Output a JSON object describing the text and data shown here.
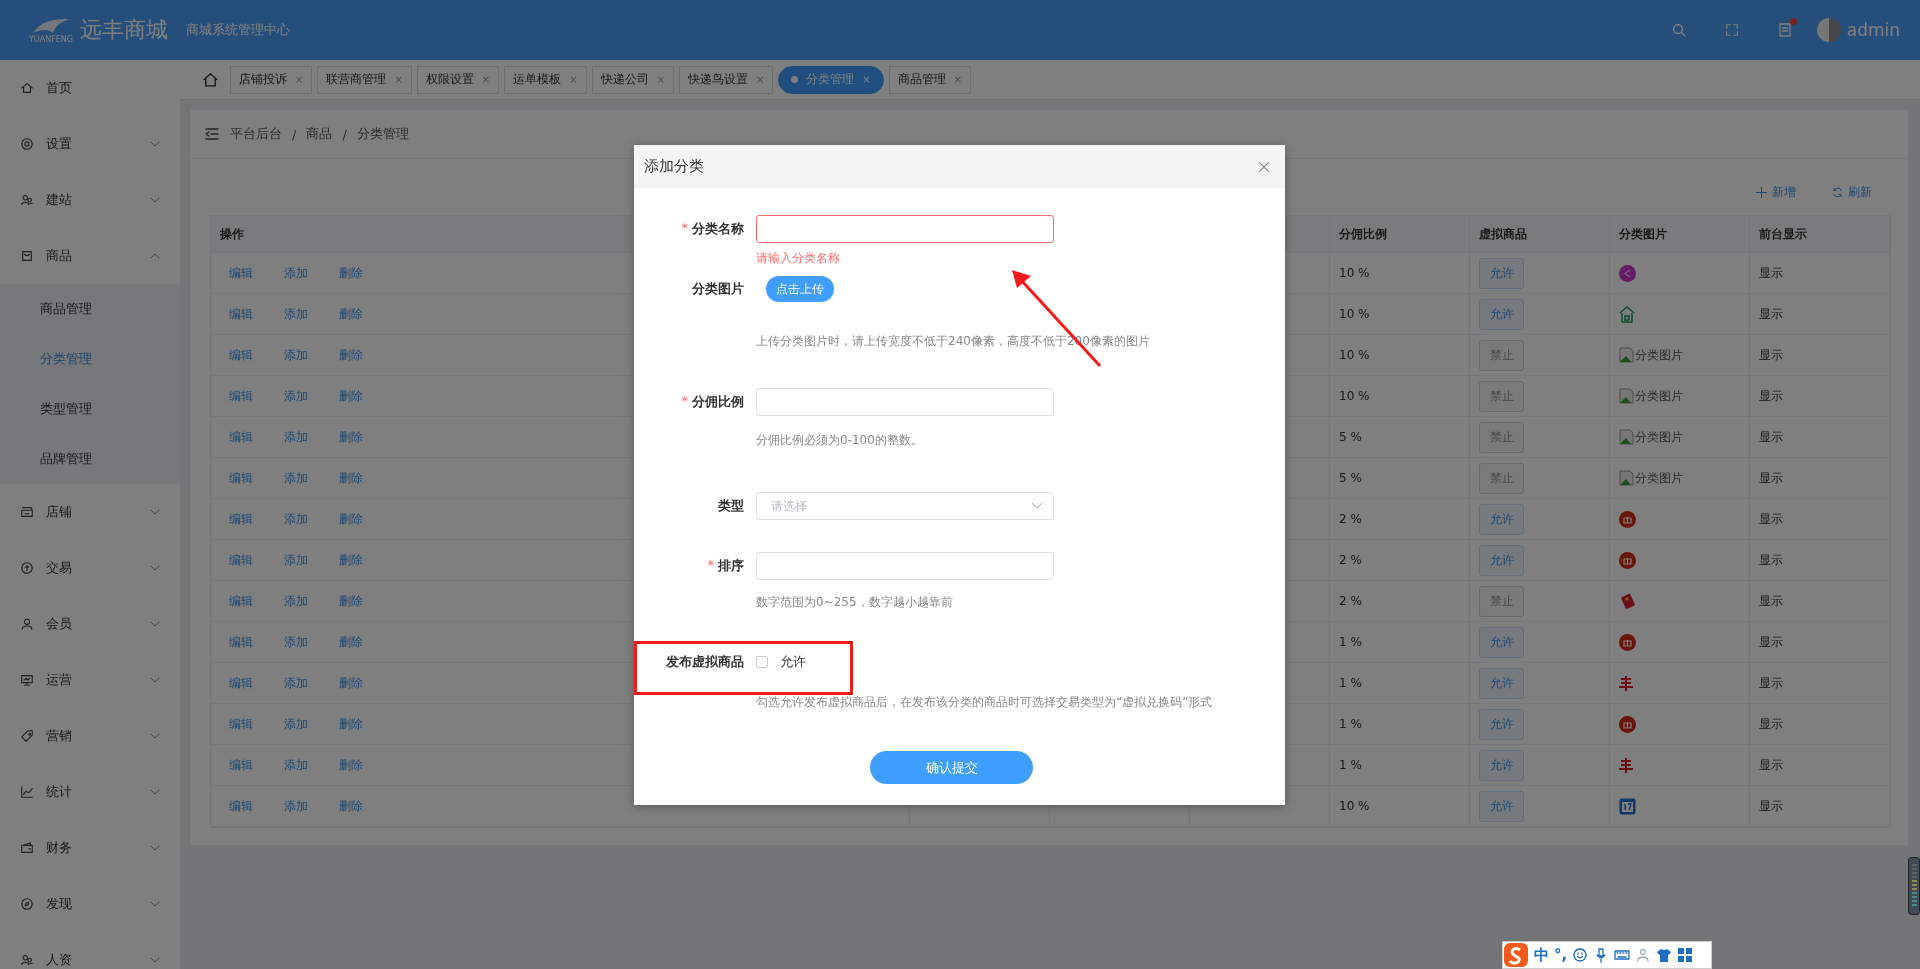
{
  "header": {
    "logo_text": "远丰商城",
    "logo_sub": "YUANFENG",
    "subtitle": "商城系统管理中心",
    "user": "admin"
  },
  "sidebar": {
    "items": [
      {
        "label": "首页",
        "kind": "link"
      },
      {
        "label": "设置",
        "kind": "menu",
        "expanded": false
      },
      {
        "label": "建站",
        "kind": "menu",
        "expanded": false
      },
      {
        "label": "商品",
        "kind": "menu",
        "expanded": true,
        "children": [
          {
            "label": "商品管理",
            "selected": false
          },
          {
            "label": "分类管理",
            "selected": true
          },
          {
            "label": "类型管理",
            "selected": false
          },
          {
            "label": "品牌管理",
            "selected": false
          }
        ]
      },
      {
        "label": "店铺",
        "kind": "menu",
        "expanded": false
      },
      {
        "label": "交易",
        "kind": "menu",
        "expanded": false
      },
      {
        "label": "会员",
        "kind": "menu",
        "expanded": false
      },
      {
        "label": "运营",
        "kind": "menu",
        "expanded": false
      },
      {
        "label": "营销",
        "kind": "menu",
        "expanded": false
      },
      {
        "label": "统计",
        "kind": "menu",
        "expanded": false
      },
      {
        "label": "财务",
        "kind": "menu",
        "expanded": false
      },
      {
        "label": "发现",
        "kind": "menu",
        "expanded": false
      },
      {
        "label": "人资",
        "kind": "menu",
        "expanded": false
      }
    ]
  },
  "tabs": [
    {
      "label": "店铺投诉",
      "close": "×",
      "selected": false
    },
    {
      "label": "联营商管理",
      "close": "×",
      "selected": false
    },
    {
      "label": "权限设置",
      "close": "×",
      "selected": false
    },
    {
      "label": "运单模板",
      "close": "×",
      "selected": false
    },
    {
      "label": "快递公司",
      "close": "×",
      "selected": false
    },
    {
      "label": "快递鸟设置",
      "close": "×",
      "selected": false
    },
    {
      "label": "分类管理",
      "close": "×",
      "selected": true
    },
    {
      "label": "商品管理",
      "close": "×",
      "selected": false
    }
  ],
  "breadcrumb": [
    "平台后台",
    "/",
    "商品",
    "/",
    "分类管理"
  ],
  "toolbar": {
    "add": "新增",
    "refresh": "刷新"
  },
  "table": {
    "columns": [
      "操作",
      "分佣比例",
      "虚拟商品",
      "分类图片",
      "前台显示"
    ],
    "rows": [
      {
        "actions": [
          "编辑",
          "添加",
          "删除"
        ],
        "rate": "10 %",
        "virtual": {
          "label": "允许",
          "allowed": true
        },
        "image": {
          "kind": "share"
        },
        "display": "显示"
      },
      {
        "actions": [
          "编辑",
          "添加",
          "删除"
        ],
        "rate": "10 %",
        "virtual": {
          "label": "允许",
          "allowed": true
        },
        "image": {
          "kind": "house"
        },
        "display": "显示"
      },
      {
        "actions": [
          "编辑",
          "添加",
          "删除"
        ],
        "rate": "10 %",
        "virtual": {
          "label": "禁止",
          "allowed": false
        },
        "image": {
          "kind": "broken",
          "alt": "分类图片"
        },
        "display": "显示"
      },
      {
        "actions": [
          "编辑",
          "添加",
          "删除"
        ],
        "rate": "10 %",
        "virtual": {
          "label": "禁止",
          "allowed": false
        },
        "image": {
          "kind": "broken",
          "alt": "分类图片"
        },
        "display": "显示"
      },
      {
        "actions": [
          "编辑",
          "添加",
          "删除"
        ],
        "rate": "5 %",
        "virtual": {
          "label": "禁止",
          "allowed": false
        },
        "image": {
          "kind": "broken",
          "alt": "分类图片"
        },
        "display": "显示"
      },
      {
        "actions": [
          "编辑",
          "添加",
          "删除"
        ],
        "rate": "5 %",
        "virtual": {
          "label": "禁止",
          "allowed": false
        },
        "image": {
          "kind": "broken",
          "alt": "分类图片"
        },
        "display": "显示"
      },
      {
        "actions": [
          "编辑",
          "添加",
          "删除"
        ],
        "rate": "2 %",
        "virtual": {
          "label": "允许",
          "allowed": true
        },
        "image": {
          "kind": "gift"
        },
        "display": "显示"
      },
      {
        "actions": [
          "编辑",
          "添加",
          "删除"
        ],
        "rate": "2 %",
        "virtual": {
          "label": "允许",
          "allowed": true
        },
        "image": {
          "kind": "gift"
        },
        "display": "显示"
      },
      {
        "actions": [
          "编辑",
          "添加",
          "删除"
        ],
        "rate": "2 %",
        "virtual": {
          "label": "禁止",
          "allowed": false
        },
        "image": {
          "kind": "envelope"
        },
        "display": "显示"
      },
      {
        "actions": [
          "编辑",
          "添加",
          "删除"
        ],
        "rate": "1 %",
        "virtual": {
          "label": "允许",
          "allowed": true
        },
        "image": {
          "kind": "gift"
        },
        "display": "显示"
      },
      {
        "actions": [
          "编辑",
          "添加",
          "删除"
        ],
        "rate": "1 %",
        "virtual": {
          "label": "允许",
          "allowed": true
        },
        "image": {
          "kind": "mark"
        },
        "display": "显示"
      },
      {
        "actions": [
          "编辑",
          "添加",
          "删除"
        ],
        "rate": "1 %",
        "virtual": {
          "label": "允许",
          "allowed": true
        },
        "image": {
          "kind": "gift"
        },
        "display": "显示"
      },
      {
        "actions": [
          "编辑",
          "添加",
          "删除"
        ],
        "rate": "1 %",
        "virtual": {
          "label": "允许",
          "allowed": true
        },
        "image": {
          "kind": "mark"
        },
        "display": "显示"
      },
      {
        "actions": [
          "编辑",
          "添加",
          "删除"
        ],
        "rate": "10 %",
        "virtual": {
          "label": "允许",
          "allowed": true
        },
        "image": {
          "kind": "calendar"
        },
        "display": "显示"
      }
    ]
  },
  "modal": {
    "title": "添加分类",
    "fields": [
      {
        "kind": "input",
        "mark": "*",
        "label": "分类名称",
        "invalid": true,
        "error": "请输入分类名称"
      },
      {
        "kind": "upload",
        "label": "分类图片",
        "button": "点击上传",
        "hint": "上传分类图片时，请上传宽度不低于240像素，高度不低于200像素的图片"
      },
      {
        "kind": "input",
        "mark": "*",
        "label": "分佣比例",
        "invalid": false,
        "hint": "分佣比例必须为0-100的整数。"
      },
      {
        "kind": "select",
        "label": "类型",
        "placeholder": "请选择"
      },
      {
        "kind": "input",
        "mark": "*",
        "label": "排序",
        "invalid": false,
        "hint": "数字范围为0~255，数字越小越靠前"
      },
      {
        "kind": "checkbox",
        "label": "发布虚拟商品",
        "option": "允许",
        "checked": false,
        "hint": "勾选允许发布虚拟商品后，在发布该分类的商品时可选择交易类型为“虚拟兑换码”形式"
      }
    ],
    "submit": "确认提交"
  },
  "ime": {
    "mode": "中",
    "punct": "°,"
  }
}
